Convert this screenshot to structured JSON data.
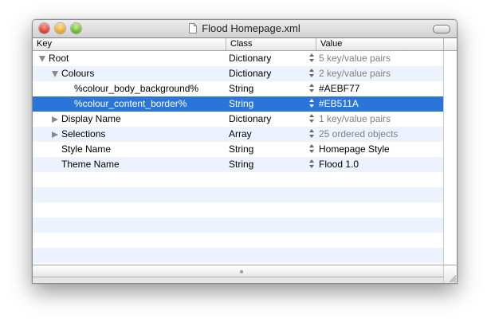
{
  "window": {
    "title": "Flood Homepage.xml"
  },
  "columns": {
    "key": "Key",
    "class": "Class",
    "value": "Value"
  },
  "rows": [
    {
      "key": "Root",
      "class": "Dictionary",
      "value": "5 key/value pairs",
      "indent": 0,
      "disclosure": "expanded",
      "value_dim": true,
      "style": "plain"
    },
    {
      "key": "Colours",
      "class": "Dictionary",
      "value": "2 key/value pairs",
      "indent": 1,
      "disclosure": "expanded",
      "value_dim": true,
      "style": "alt"
    },
    {
      "key": "%colour_body_background%",
      "class": "String",
      "value": "#AEBF77",
      "indent": 2,
      "disclosure": "none",
      "value_dim": false,
      "style": "plain"
    },
    {
      "key": "%colour_content_border%",
      "class": "String",
      "value": "#EB511A",
      "indent": 2,
      "disclosure": "none",
      "value_dim": false,
      "style": "selected"
    },
    {
      "key": "Display Name",
      "class": "Dictionary",
      "value": "1 key/value pairs",
      "indent": 1,
      "disclosure": "collapsed",
      "value_dim": true,
      "style": "plain"
    },
    {
      "key": "Selections",
      "class": "Array",
      "value": "25 ordered objects",
      "indent": 1,
      "disclosure": "collapsed",
      "value_dim": true,
      "style": "alt"
    },
    {
      "key": "Style Name",
      "class": "String",
      "value": "Homepage Style",
      "indent": 1,
      "disclosure": "none",
      "value_dim": false,
      "style": "plain"
    },
    {
      "key": "Theme Name",
      "class": "String",
      "value": "Flood 1.0",
      "indent": 1,
      "disclosure": "none",
      "value_dim": false,
      "style": "alt"
    }
  ],
  "colors": {
    "selection": "#2b75d8",
    "stripe": "#edf3fe"
  }
}
